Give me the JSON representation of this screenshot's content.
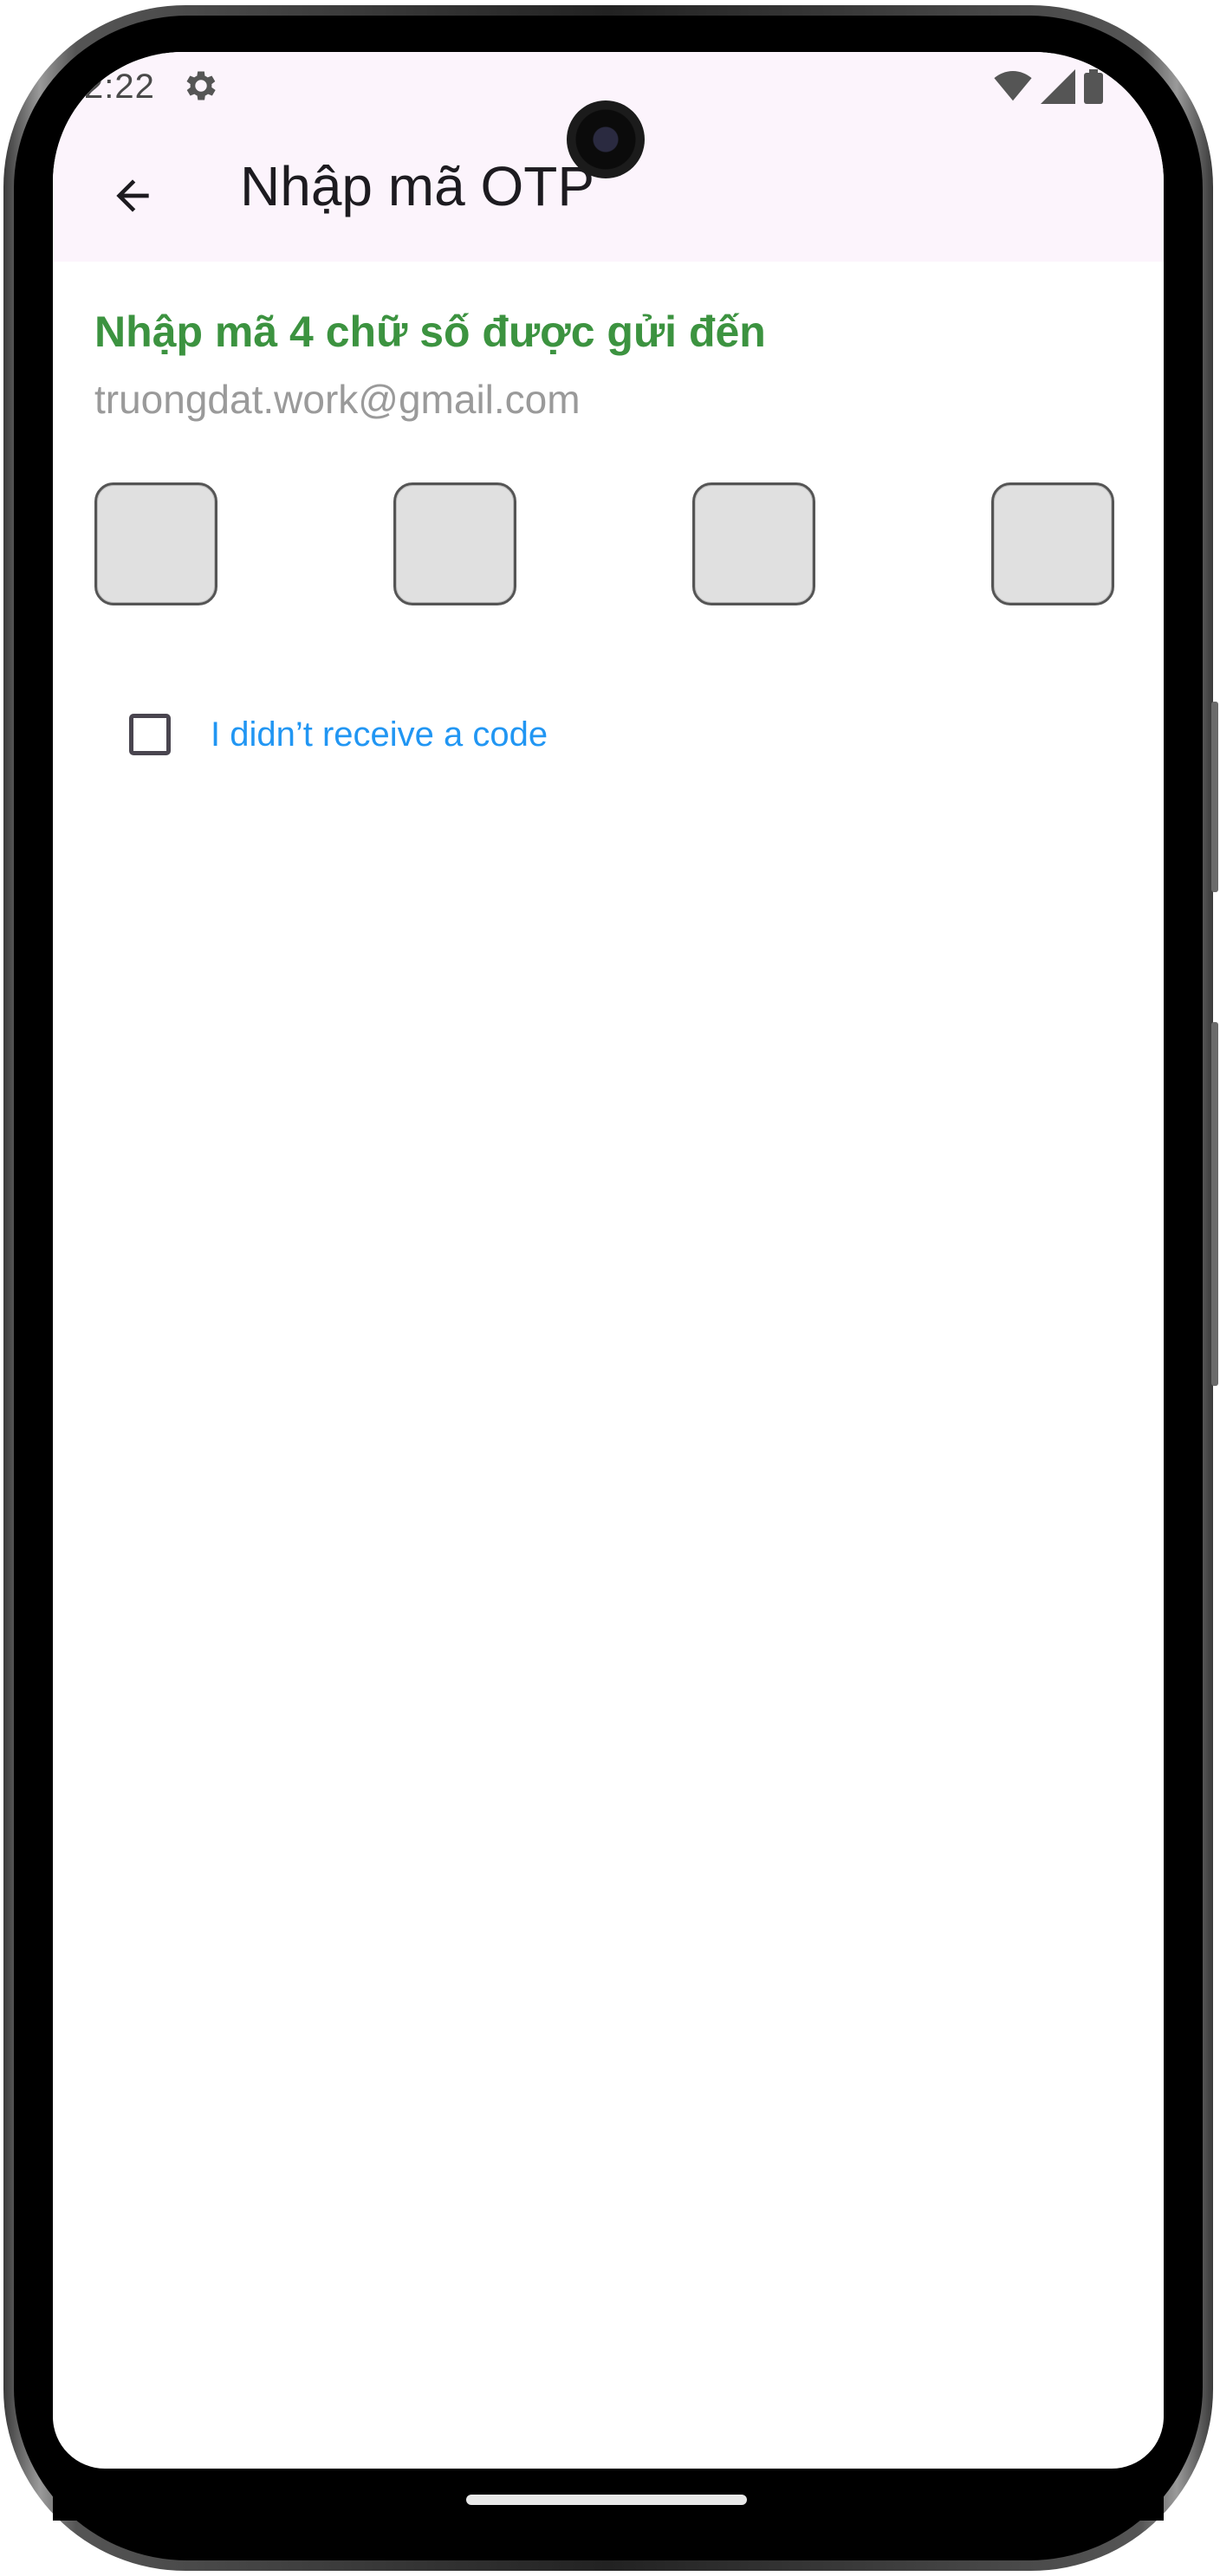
{
  "status_bar": {
    "time": "2:22",
    "settings_icon": "gear-icon",
    "icons": [
      "wifi-icon",
      "cell-signal-icon",
      "battery-icon"
    ]
  },
  "app_bar": {
    "back_icon": "arrow-back-icon",
    "title": "Nhập mã OTP",
    "background": "#fcf4fc"
  },
  "main": {
    "heading": "Nhập mã 4 chữ số được gửi đến",
    "email": "truongdat.work@gmail.com",
    "otp_digits": [
      "",
      "",
      "",
      ""
    ],
    "resend_checkbox": {
      "checked": false,
      "label": "I didn’t receive a code"
    }
  },
  "colors": {
    "heading": "#3c9340",
    "link": "#2196f3",
    "box_fill": "#e0e0e0"
  }
}
